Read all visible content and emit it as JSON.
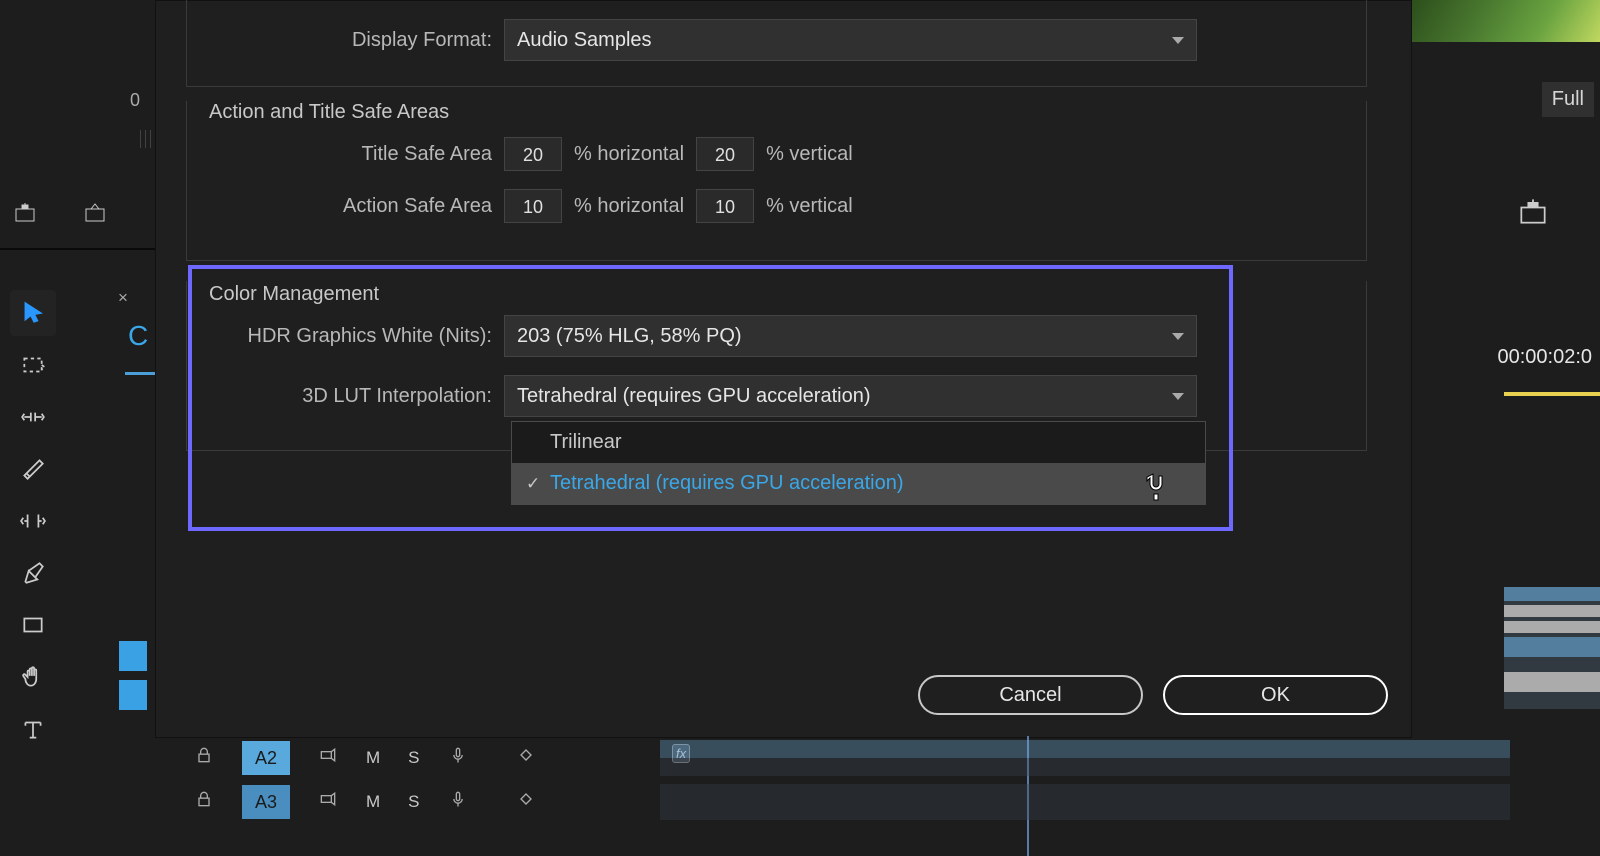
{
  "bg": {
    "timecode_left": "0",
    "c_letter": "C",
    "close_x": "×"
  },
  "right": {
    "full_label": "Full",
    "timecode": "00:00:02:0"
  },
  "dialog": {
    "display_format_label": "Display Format:",
    "display_format_value": "Audio Samples",
    "safe_areas_title": "Action and Title Safe Areas",
    "title_safe_label": "Title Safe Area",
    "title_safe_h": "20",
    "title_safe_v": "20",
    "action_safe_label": "Action Safe Area",
    "action_safe_h": "10",
    "action_safe_v": "10",
    "pct_h": "% horizontal",
    "pct_v": "% vertical",
    "color_mgmt_title": "Color Management",
    "hdr_label": "HDR Graphics White (Nits):",
    "hdr_value": "203 (75% HLG, 58% PQ)",
    "lut_label": "3D LUT Interpolation:",
    "lut_value": "Tetrahedral (requires GPU acceleration)",
    "lut_options": [
      "Trilinear",
      "Tetrahedral (requires GPU acceleration)"
    ],
    "cancel": "Cancel",
    "ok": "OK"
  },
  "timeline": {
    "a2": "A2",
    "a3": "A3",
    "m": "M",
    "s": "S",
    "fx": "fx"
  }
}
